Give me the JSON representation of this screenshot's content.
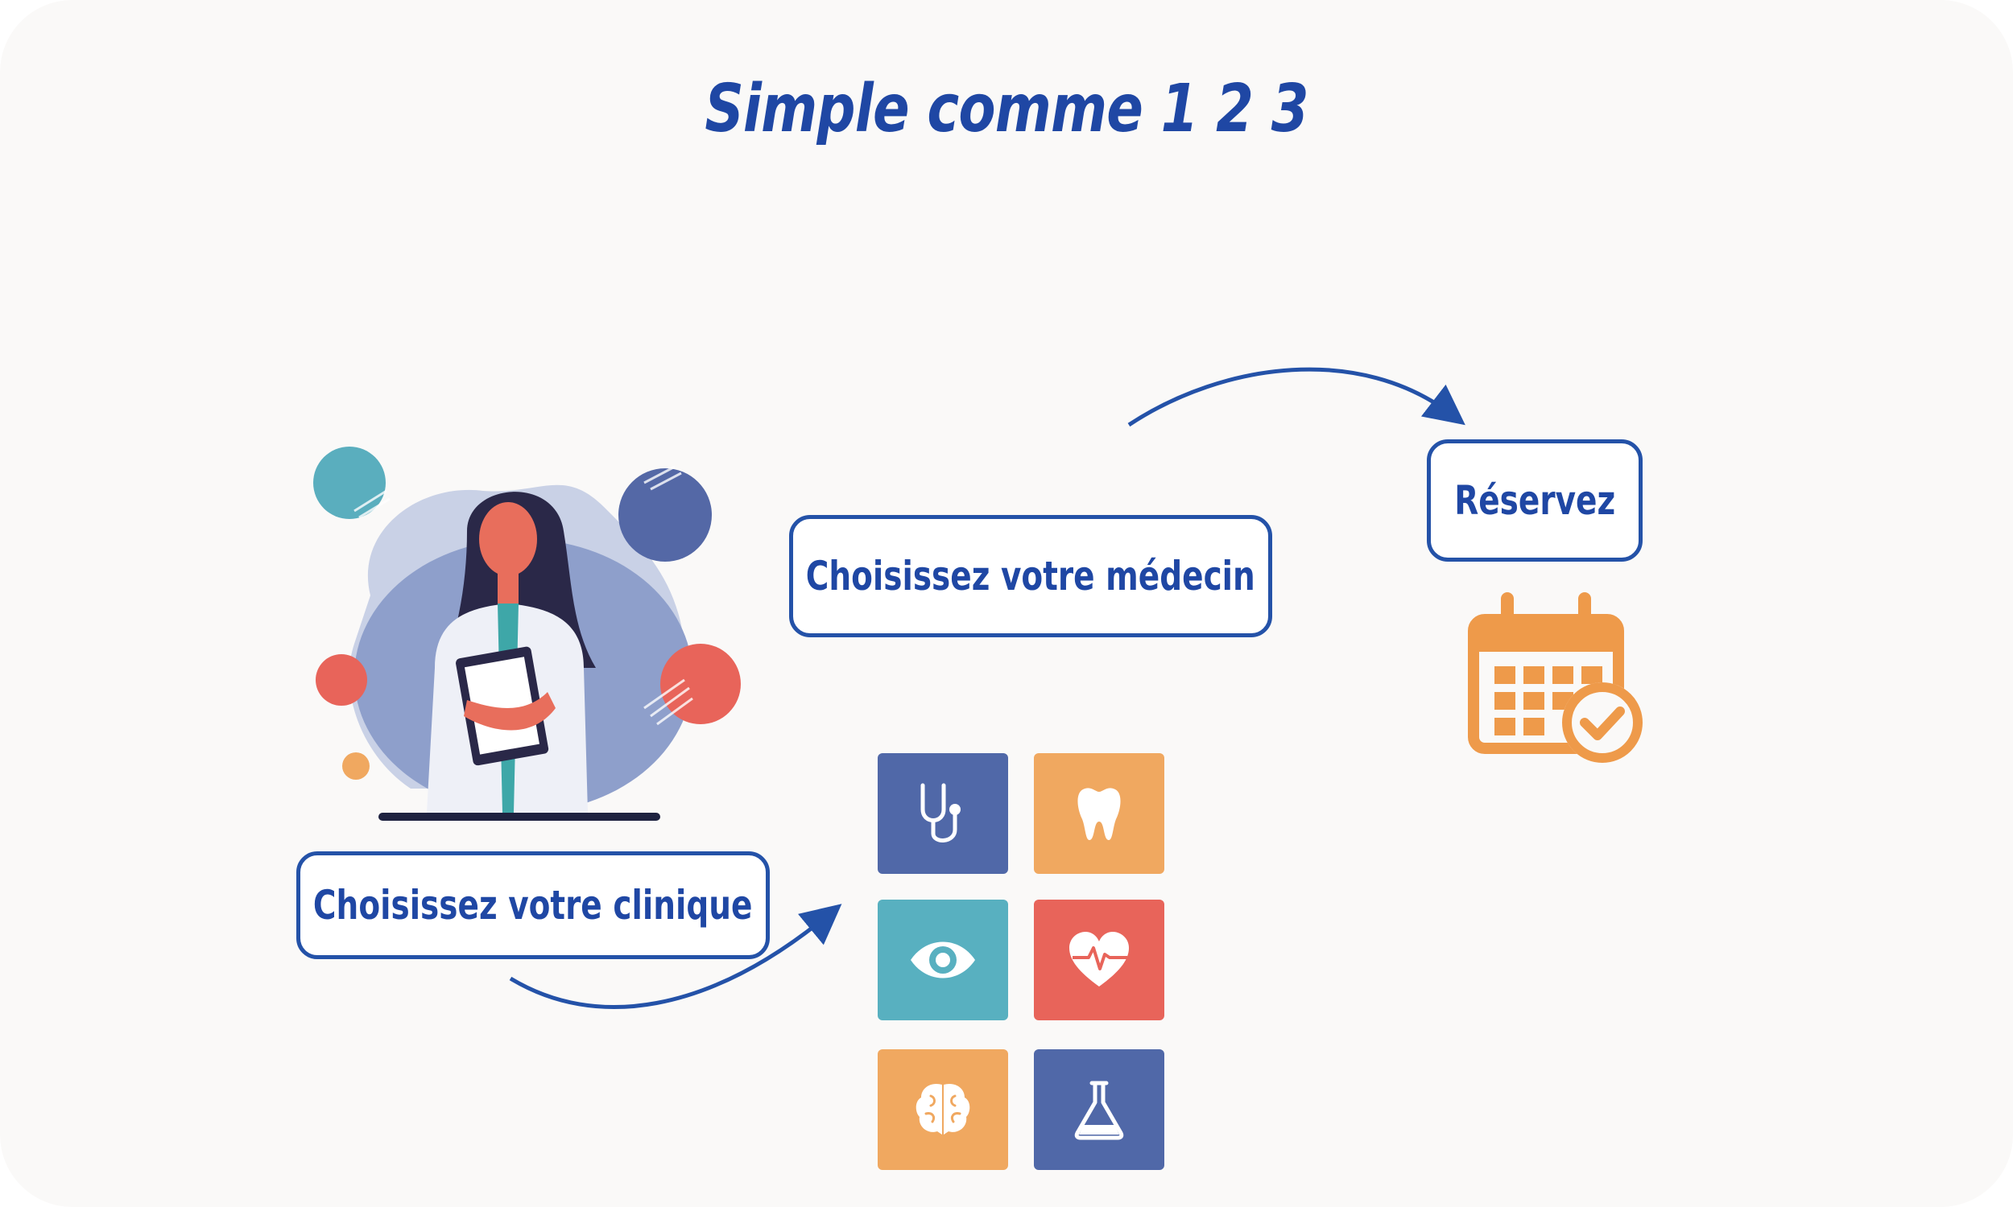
{
  "title": "Simple comme 1  2 3",
  "steps": {
    "clinic": "Choisissez votre clinique",
    "doctor": "Choisissez votre médecin",
    "book": "Réservez"
  },
  "colors": {
    "primary": "#1f47a4",
    "arrow": "#2452a8",
    "tile_blue": "#5068a8",
    "tile_orange": "#f0a860",
    "tile_teal": "#58b0c0",
    "tile_red": "#e8645a",
    "calendar": "#ee9a4a"
  },
  "specialties": [
    {
      "icon": "stethoscope-icon",
      "color": "#5068a8"
    },
    {
      "icon": "tooth-icon",
      "color": "#f0a860"
    },
    {
      "icon": "eye-icon",
      "color": "#58b0c0"
    },
    {
      "icon": "heart-pulse-icon",
      "color": "#e8645a"
    },
    {
      "icon": "brain-icon",
      "color": "#f0a860"
    },
    {
      "icon": "flask-icon",
      "color": "#5068a8"
    }
  ]
}
